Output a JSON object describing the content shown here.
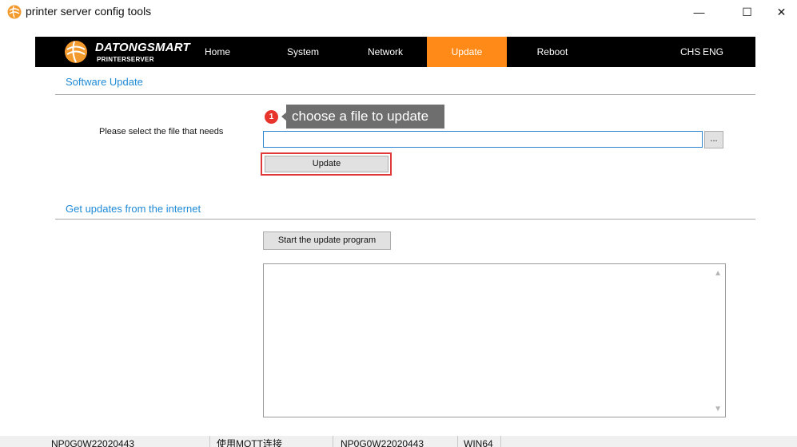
{
  "window": {
    "title": "printer server config tools",
    "minimize_glyph": "—",
    "maximize_glyph": "☐",
    "close_glyph": "✕"
  },
  "navbar": {
    "brand": "DATONGSMART",
    "brand_sub": "PRINTERSERVER",
    "items": [
      {
        "label": "Home"
      },
      {
        "label": "System"
      },
      {
        "label": "Network"
      },
      {
        "label": "Update",
        "active": true
      },
      {
        "label": "Reboot"
      }
    ],
    "lang_chs": "CHS",
    "lang_eng": "ENG",
    "active_color": "#ff8a17"
  },
  "software_update": {
    "section_title": "Software Update",
    "file_label": "Please select the file that needs",
    "file_value": "",
    "browse_label": "...",
    "update_label": "Update",
    "tooltip": {
      "badge": "1",
      "text": "choose a file to update"
    }
  },
  "internet_update": {
    "section_title": "Get updates from the internet",
    "start_label": "Start the update program",
    "log_text": ""
  },
  "statusbar": {
    "cells": [
      "NP0G0W22020443",
      "使用MQTT连接",
      "NP0G0W22020443",
      "WIN64"
    ]
  },
  "colors": {
    "accent_blue": "#1f8ad6",
    "highlight_red": "#e0393a",
    "badge_red": "#e8352c"
  }
}
